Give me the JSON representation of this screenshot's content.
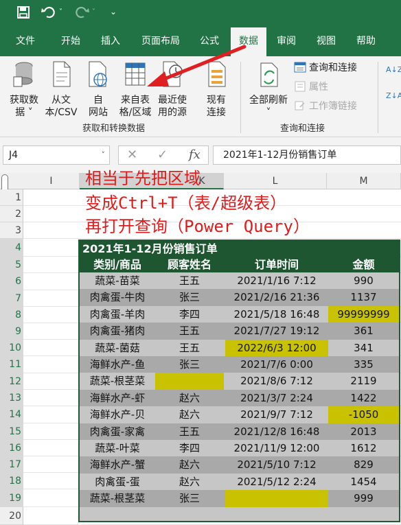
{
  "quick_access": {
    "save_icon": "save-icon",
    "undo_icon": "undo-icon",
    "redo_icon": "redo-icon",
    "customize_icon": "customize-icon"
  },
  "tabs": [
    "文件",
    "开始",
    "插入",
    "页面布局",
    "公式",
    "数据",
    "审阅",
    "视图",
    "帮助"
  ],
  "active_tab": "数据",
  "ribbon": {
    "get_transform": {
      "label": "获取和转换数据",
      "buttons": [
        {
          "line1": "获取数",
          "line2": "据 ˅"
        },
        {
          "line1": "从文",
          "line2": "本/CSV"
        },
        {
          "line1": "自",
          "line2": "网站"
        },
        {
          "line1": "来自表",
          "line2": "格/区域"
        },
        {
          "line1": "最近使",
          "line2": "用的源"
        },
        {
          "line1": "现有",
          "line2": "连接"
        }
      ]
    },
    "queries": {
      "label": "查询和连接",
      "refresh": {
        "line1": "全部刷新",
        "line2": "˅"
      },
      "items": [
        "查询和连接",
        "属性",
        "工作簿链接"
      ]
    },
    "sort_icons": [
      "A↓Z",
      "Z↓A"
    ]
  },
  "formula_bar": {
    "name_box": "J4",
    "cancel": "✕",
    "enter": "✓",
    "fx": "fx",
    "content": "2021年1-12月份销售订单"
  },
  "columns": [
    "I",
    "J",
    "K",
    "L",
    "M"
  ],
  "rows": [
    "1",
    "2",
    "3",
    "4",
    "5",
    "6",
    "7",
    "8",
    "9",
    "10",
    "11",
    "12",
    "13",
    "14",
    "15",
    "16",
    "17",
    "18",
    "19",
    "20"
  ],
  "annotation": [
    "相当于先把区域",
    "变成Ctrl+T（表/超级表）",
    "再打开查询（Power Query）"
  ],
  "table": {
    "title": "2021年1-12月份销售订单",
    "headers": [
      "类别/商品",
      "顾客姓名",
      "订单时间",
      "金额"
    ],
    "rows": [
      [
        "蔬菜-苗菜",
        "王五",
        "2021/1/16 7:12",
        "990"
      ],
      [
        "肉禽蛋-牛肉",
        "张三",
        "2021/2/16 21:36",
        "1137"
      ],
      [
        "肉禽蛋-羊肉",
        "李四",
        "2021/5/18 16:48",
        "99999999"
      ],
      [
        "肉禽蛋-猪肉",
        "王五",
        "2021/7/27 19:12",
        "361"
      ],
      [
        "蔬菜-菌菇",
        "王五",
        "2022/6/3 12:00",
        "341"
      ],
      [
        "海鲜水产-鱼",
        "张三",
        "2021/7/6 0:00",
        "335"
      ],
      [
        "蔬菜-根茎菜",
        "",
        "2021/8/6 7:12",
        "2119"
      ],
      [
        "海鲜水产-虾",
        "赵六",
        "2021/3/7 2:24",
        "1422"
      ],
      [
        "海鲜水产-贝",
        "赵六",
        "2021/9/7 7:12",
        "-1050"
      ],
      [
        "肉禽蛋-家禽",
        "王五",
        "2021/12/8 16:48",
        "2013"
      ],
      [
        "蔬菜-叶菜",
        "李四",
        "2021/11/9 12:00",
        "1612"
      ],
      [
        "海鲜水产-蟹",
        "赵六",
        "2021/5/10 7:12",
        "829"
      ],
      [
        "肉禽蛋-蛋",
        "赵六",
        "2021/5/12 2:24",
        "1454"
      ],
      [
        "蔬菜-根茎菜",
        "张三",
        "",
        "999"
      ]
    ]
  },
  "colors": {
    "excel_green": "#217346",
    "highlight": "#c9c200",
    "annotation_red": "#e11b1b",
    "table_header": "#1d5630"
  }
}
